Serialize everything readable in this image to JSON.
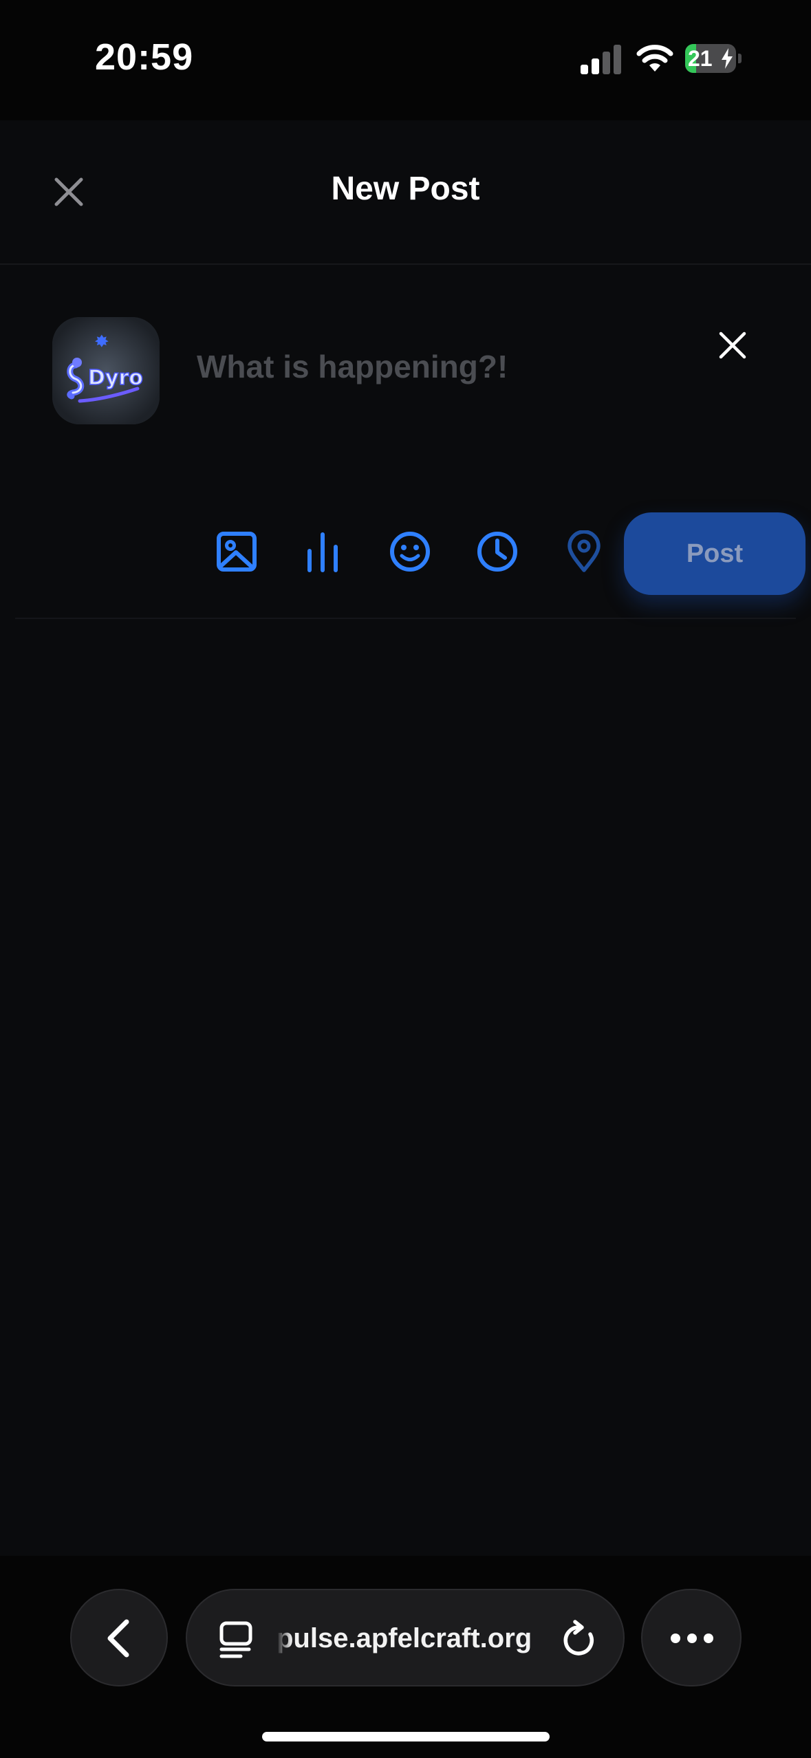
{
  "status_bar": {
    "time": "20:59",
    "battery_level": "21",
    "battery_fraction": 0.21,
    "battery_color": "#34c759",
    "signal_icon": "cellular-signal-icon",
    "wifi_icon": "wifi-icon",
    "charging_icon": "bolt-icon"
  },
  "header": {
    "title": "New Post",
    "close_icon": "close-icon"
  },
  "composer": {
    "avatar_text": "Dyro",
    "placeholder": "What is happening?!",
    "clear_icon": "close-icon",
    "tools": [
      {
        "name": "image",
        "icon": "image-icon"
      },
      {
        "name": "poll",
        "icon": "poll-icon"
      },
      {
        "name": "emoji",
        "icon": "emoji-icon"
      },
      {
        "name": "schedule",
        "icon": "clock-icon"
      },
      {
        "name": "location",
        "icon": "location-pin-icon"
      }
    ],
    "post_label": "Post",
    "accent_color": "#2f80ff",
    "post_button_color": "#1c4a9c"
  },
  "browser": {
    "url": "pulse.apfelcraft.org",
    "back_icon": "chevron-left-icon",
    "tabs_icon": "tabs-icon",
    "reload_icon": "reload-icon",
    "more_icon": "ellipsis-icon"
  }
}
